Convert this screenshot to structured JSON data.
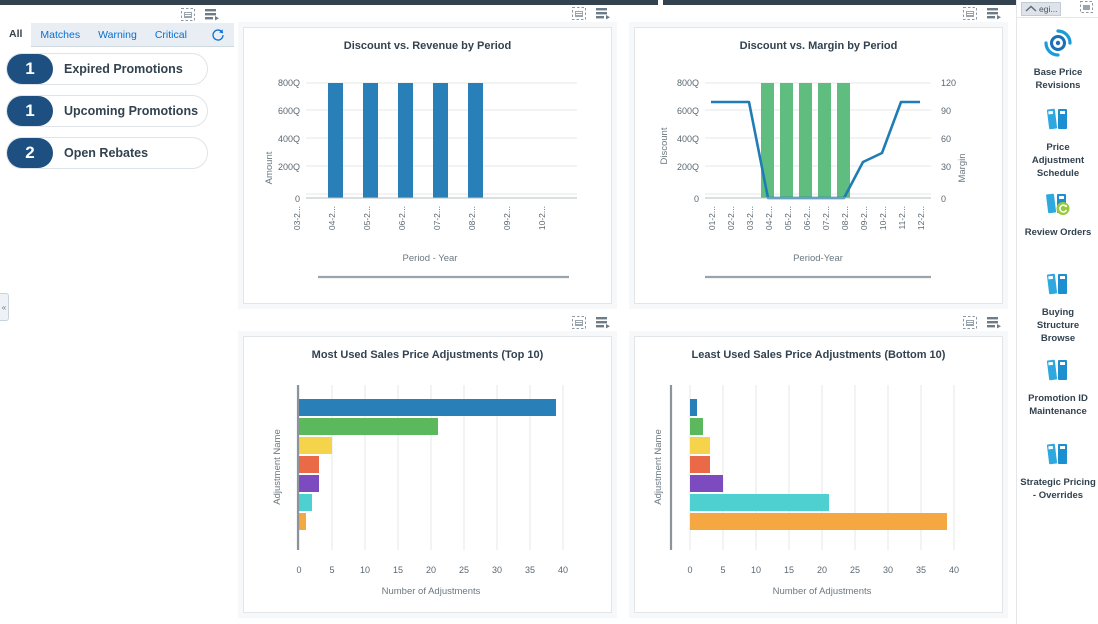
{
  "left_panel": {
    "toolbar_icons": [
      "expand-icon",
      "legend-icon"
    ],
    "tabs": [
      {
        "label": "All",
        "active": true
      },
      {
        "label": "Matches",
        "active": false
      },
      {
        "label": "Warning",
        "active": false
      },
      {
        "label": "Critical",
        "active": false
      }
    ],
    "refresh_icon": "refresh-icon",
    "alerts": [
      {
        "count": "1",
        "label": "Expired Promotions"
      },
      {
        "count": "1",
        "label": "Upcoming Promotions"
      },
      {
        "count": "2",
        "label": "Open Rebates"
      }
    ],
    "collapse_handle": "«"
  },
  "chart_toolbars": {
    "expand_icon": "expand-icon",
    "legend_icon": "legend-icon"
  },
  "right_rail": {
    "chip_label": "egi...",
    "chip_icon": "collapse-icon",
    "top_icon": "expand-icon",
    "items": [
      {
        "label": "Base Price Revisions",
        "icon": "sync-circle-icon"
      },
      {
        "label": "Price Adjustment Schedule",
        "icon": "books-icon"
      },
      {
        "label": "Review Orders",
        "icon": "books-refresh-icon"
      },
      {
        "label": "Buying Structure Browse",
        "icon": "books-icon"
      },
      {
        "label": "Promotion ID Maintenance",
        "icon": "books-icon"
      },
      {
        "label": "Strategic Pricing - Overrides",
        "icon": "books-icon"
      }
    ]
  },
  "colors": {
    "bar_blue": "#2980b9",
    "bar_green": "#5fbd7f",
    "line_blue": "#1f7cb4",
    "accent_navy": "#1d4f81",
    "link_blue": "#0a6ed1",
    "palette": [
      "#2980b9",
      "#5cb85c",
      "#f5d44c",
      "#ea6a47",
      "#7d4bc0",
      "#4fd0d0",
      "#f5a742"
    ]
  },
  "chart_data": [
    {
      "id": "discount-vs-revenue",
      "type": "bar",
      "title": "Discount vs. Revenue by Period",
      "xlabel": "Period - Year",
      "ylabel": "Amount",
      "categories": [
        "03-2...",
        "04-2...",
        "05-2...",
        "06-2...",
        "07-2...",
        "08-2...",
        "09-2...",
        "10-2..."
      ],
      "values": [
        0,
        800,
        800,
        800,
        800,
        800,
        0,
        0
      ],
      "ytick_labels": [
        "0",
        "200Q",
        "400Q",
        "600Q",
        "800Q"
      ],
      "ytick_values": [
        0,
        200,
        400,
        600,
        800
      ],
      "ylim": [
        0,
        800
      ],
      "grid": true,
      "legend": "none"
    },
    {
      "id": "discount-vs-margin",
      "type": "bar+line",
      "title": "Discount vs. Margin by Period",
      "xlabel": "Period-Year",
      "ylabel": "Discount",
      "y2label": "Margin",
      "categories": [
        "01-2...",
        "02-2...",
        "03-2...",
        "04-2...",
        "05-2...",
        "06-2...",
        "07-2...",
        "08-2...",
        "09-2...",
        "10-2...",
        "11-2...",
        "12-2..."
      ],
      "series": [
        {
          "name": "Discount",
          "type": "bar",
          "axis": "left",
          "values": [
            0,
            0,
            0,
            800,
            800,
            800,
            800,
            800,
            0,
            0,
            0,
            0
          ]
        },
        {
          "name": "Margin",
          "type": "line",
          "axis": "right",
          "values": [
            100,
            100,
            100,
            0,
            0,
            0,
            0,
            0,
            30,
            40,
            100,
            100
          ]
        }
      ],
      "ytick_labels": [
        "0",
        "200Q",
        "400Q",
        "600Q",
        "800Q"
      ],
      "ytick_values": [
        0,
        200,
        400,
        600,
        800
      ],
      "y2tick_labels": [
        "0",
        "30",
        "60",
        "90",
        "120"
      ],
      "y2tick_values": [
        0,
        30,
        60,
        90,
        120
      ],
      "ylim": [
        0,
        800
      ],
      "y2lim": [
        0,
        120
      ],
      "grid": true,
      "legend": "none"
    },
    {
      "id": "most-used-adjustments",
      "type": "bar",
      "orientation": "horizontal",
      "title": "Most Used Sales Price Adjustments (Top 10)",
      "xlabel": "Number of Adjustments",
      "ylabel": "Adjustment Name",
      "categories": [
        "",
        "",
        "",
        "",
        "",
        "",
        ""
      ],
      "values": [
        39,
        21,
        5,
        3,
        3,
        2,
        1
      ],
      "bar_colors": [
        "#2980b9",
        "#5cb85c",
        "#f5d44c",
        "#ea6a47",
        "#7d4bc0",
        "#4fd0d0",
        "#f5a742"
      ],
      "xtick_labels": [
        "0",
        "5",
        "10",
        "15",
        "20",
        "25",
        "30",
        "35",
        "40"
      ],
      "xtick_values": [
        0,
        5,
        10,
        15,
        20,
        25,
        30,
        35,
        40
      ],
      "xlim": [
        0,
        40
      ],
      "grid": true,
      "legend": "none"
    },
    {
      "id": "least-used-adjustments",
      "type": "bar",
      "orientation": "horizontal",
      "title": "Least Used Sales Price Adjustments (Bottom 10)",
      "xlabel": "Number of Adjustments",
      "ylabel": "Adjustment Name",
      "categories": [
        "",
        "",
        "",
        "",
        "",
        "",
        ""
      ],
      "values": [
        1,
        2,
        3,
        3,
        5,
        21,
        39
      ],
      "bar_colors": [
        "#2980b9",
        "#5cb85c",
        "#f5d44c",
        "#ea6a47",
        "#7d4bc0",
        "#4fd0d0",
        "#f5a742"
      ],
      "xtick_labels": [
        "0",
        "5",
        "10",
        "15",
        "20",
        "25",
        "30",
        "35",
        "40"
      ],
      "xtick_values": [
        0,
        5,
        10,
        15,
        20,
        25,
        30,
        35,
        40
      ],
      "xlim": [
        0,
        40
      ],
      "grid": true,
      "legend": "none"
    }
  ]
}
